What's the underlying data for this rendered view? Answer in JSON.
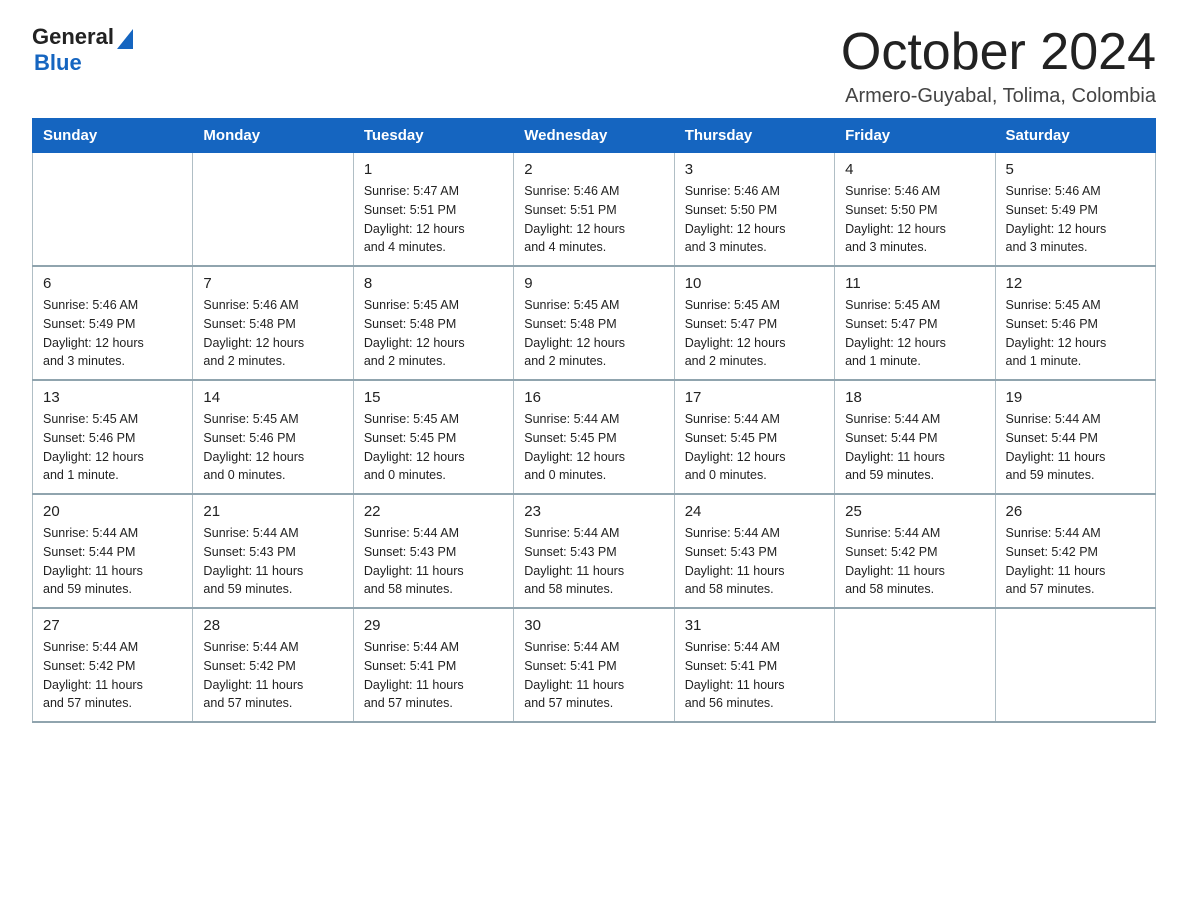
{
  "header": {
    "logo_general": "General",
    "logo_blue": "Blue",
    "main_title": "October 2024",
    "subtitle": "Armero-Guyabal, Tolima, Colombia"
  },
  "calendar": {
    "days_of_week": [
      "Sunday",
      "Monday",
      "Tuesday",
      "Wednesday",
      "Thursday",
      "Friday",
      "Saturday"
    ],
    "weeks": [
      [
        {
          "day": "",
          "detail": ""
        },
        {
          "day": "",
          "detail": ""
        },
        {
          "day": "1",
          "detail": "Sunrise: 5:47 AM\nSunset: 5:51 PM\nDaylight: 12 hours\nand 4 minutes."
        },
        {
          "day": "2",
          "detail": "Sunrise: 5:46 AM\nSunset: 5:51 PM\nDaylight: 12 hours\nand 4 minutes."
        },
        {
          "day": "3",
          "detail": "Sunrise: 5:46 AM\nSunset: 5:50 PM\nDaylight: 12 hours\nand 3 minutes."
        },
        {
          "day": "4",
          "detail": "Sunrise: 5:46 AM\nSunset: 5:50 PM\nDaylight: 12 hours\nand 3 minutes."
        },
        {
          "day": "5",
          "detail": "Sunrise: 5:46 AM\nSunset: 5:49 PM\nDaylight: 12 hours\nand 3 minutes."
        }
      ],
      [
        {
          "day": "6",
          "detail": "Sunrise: 5:46 AM\nSunset: 5:49 PM\nDaylight: 12 hours\nand 3 minutes."
        },
        {
          "day": "7",
          "detail": "Sunrise: 5:46 AM\nSunset: 5:48 PM\nDaylight: 12 hours\nand 2 minutes."
        },
        {
          "day": "8",
          "detail": "Sunrise: 5:45 AM\nSunset: 5:48 PM\nDaylight: 12 hours\nand 2 minutes."
        },
        {
          "day": "9",
          "detail": "Sunrise: 5:45 AM\nSunset: 5:48 PM\nDaylight: 12 hours\nand 2 minutes."
        },
        {
          "day": "10",
          "detail": "Sunrise: 5:45 AM\nSunset: 5:47 PM\nDaylight: 12 hours\nand 2 minutes."
        },
        {
          "day": "11",
          "detail": "Sunrise: 5:45 AM\nSunset: 5:47 PM\nDaylight: 12 hours\nand 1 minute."
        },
        {
          "day": "12",
          "detail": "Sunrise: 5:45 AM\nSunset: 5:46 PM\nDaylight: 12 hours\nand 1 minute."
        }
      ],
      [
        {
          "day": "13",
          "detail": "Sunrise: 5:45 AM\nSunset: 5:46 PM\nDaylight: 12 hours\nand 1 minute."
        },
        {
          "day": "14",
          "detail": "Sunrise: 5:45 AM\nSunset: 5:46 PM\nDaylight: 12 hours\nand 0 minutes."
        },
        {
          "day": "15",
          "detail": "Sunrise: 5:45 AM\nSunset: 5:45 PM\nDaylight: 12 hours\nand 0 minutes."
        },
        {
          "day": "16",
          "detail": "Sunrise: 5:44 AM\nSunset: 5:45 PM\nDaylight: 12 hours\nand 0 minutes."
        },
        {
          "day": "17",
          "detail": "Sunrise: 5:44 AM\nSunset: 5:45 PM\nDaylight: 12 hours\nand 0 minutes."
        },
        {
          "day": "18",
          "detail": "Sunrise: 5:44 AM\nSunset: 5:44 PM\nDaylight: 11 hours\nand 59 minutes."
        },
        {
          "day": "19",
          "detail": "Sunrise: 5:44 AM\nSunset: 5:44 PM\nDaylight: 11 hours\nand 59 minutes."
        }
      ],
      [
        {
          "day": "20",
          "detail": "Sunrise: 5:44 AM\nSunset: 5:44 PM\nDaylight: 11 hours\nand 59 minutes."
        },
        {
          "day": "21",
          "detail": "Sunrise: 5:44 AM\nSunset: 5:43 PM\nDaylight: 11 hours\nand 59 minutes."
        },
        {
          "day": "22",
          "detail": "Sunrise: 5:44 AM\nSunset: 5:43 PM\nDaylight: 11 hours\nand 58 minutes."
        },
        {
          "day": "23",
          "detail": "Sunrise: 5:44 AM\nSunset: 5:43 PM\nDaylight: 11 hours\nand 58 minutes."
        },
        {
          "day": "24",
          "detail": "Sunrise: 5:44 AM\nSunset: 5:43 PM\nDaylight: 11 hours\nand 58 minutes."
        },
        {
          "day": "25",
          "detail": "Sunrise: 5:44 AM\nSunset: 5:42 PM\nDaylight: 11 hours\nand 58 minutes."
        },
        {
          "day": "26",
          "detail": "Sunrise: 5:44 AM\nSunset: 5:42 PM\nDaylight: 11 hours\nand 57 minutes."
        }
      ],
      [
        {
          "day": "27",
          "detail": "Sunrise: 5:44 AM\nSunset: 5:42 PM\nDaylight: 11 hours\nand 57 minutes."
        },
        {
          "day": "28",
          "detail": "Sunrise: 5:44 AM\nSunset: 5:42 PM\nDaylight: 11 hours\nand 57 minutes."
        },
        {
          "day": "29",
          "detail": "Sunrise: 5:44 AM\nSunset: 5:41 PM\nDaylight: 11 hours\nand 57 minutes."
        },
        {
          "day": "30",
          "detail": "Sunrise: 5:44 AM\nSunset: 5:41 PM\nDaylight: 11 hours\nand 57 minutes."
        },
        {
          "day": "31",
          "detail": "Sunrise: 5:44 AM\nSunset: 5:41 PM\nDaylight: 11 hours\nand 56 minutes."
        },
        {
          "day": "",
          "detail": ""
        },
        {
          "day": "",
          "detail": ""
        }
      ]
    ]
  }
}
